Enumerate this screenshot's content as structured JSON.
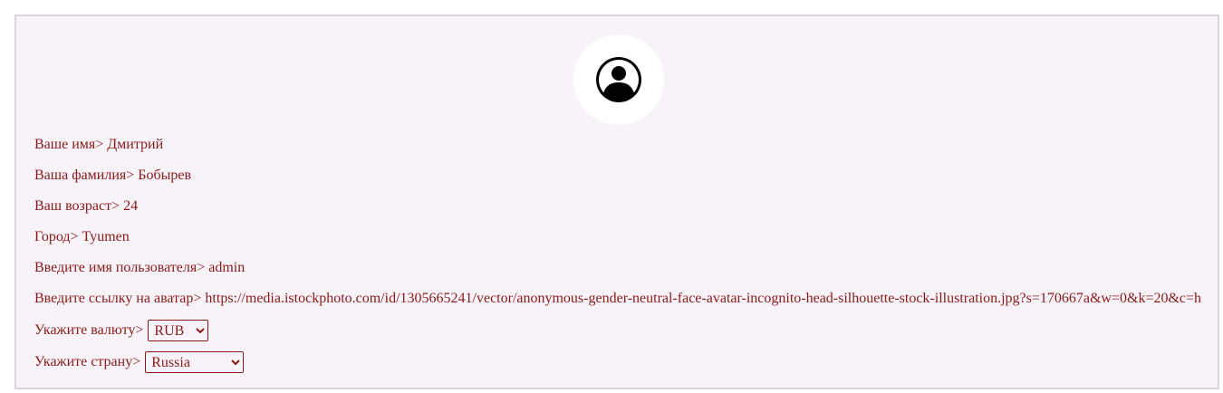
{
  "profile": {
    "avatar_icon": "user-circle-icon",
    "fields": {
      "first_name_label": "Ваше имя>",
      "first_name_value": "Дмитрий",
      "last_name_label": "Ваша фамилия>",
      "last_name_value": "Бобырев",
      "age_label": "Ваш возраст>",
      "age_value": "24",
      "city_label": "Город>",
      "city_value": "Tyumen",
      "username_label": "Введите имя пользователя>",
      "username_value": "admin",
      "avatar_url_label": "Введите ссылку на аватар>",
      "avatar_url_value": "https://media.istockphoto.com/id/1305665241/vector/anonymous-gender-neutral-face-avatar-incognito-head-silhouette-stock-illustration.jpg?s=170667a&w=0&k=20&c=h",
      "currency_label": "Укажите валюту>",
      "currency_selected": "RUB",
      "country_label": "Укажите страну>",
      "country_selected": "Russia"
    }
  },
  "colors": {
    "text": "#8a1a1a",
    "panel_bg": "#f8f3f9",
    "panel_border": "#dcd6dc"
  }
}
